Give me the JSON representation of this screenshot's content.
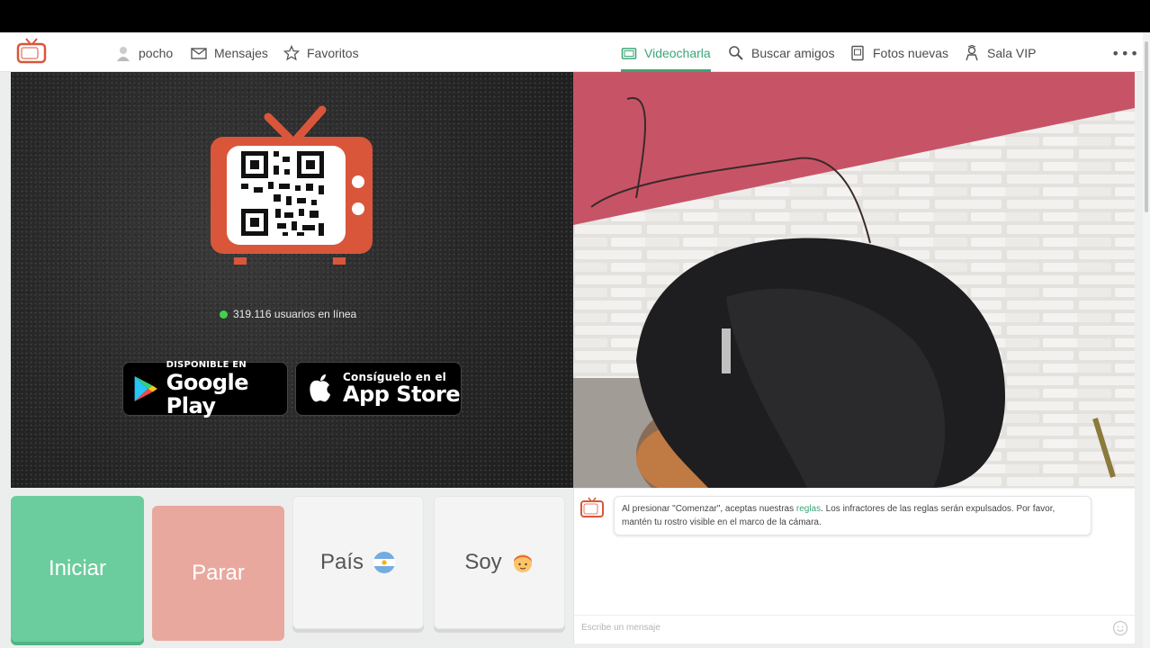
{
  "nav": {
    "user": "pocho",
    "messages": "Mensajes",
    "favorites": "Favoritos",
    "videochat": "Videocharla",
    "search_friends": "Buscar amigos",
    "new_photos": "Fotos nuevas",
    "vip_room": "Sala VIP",
    "more": "•••",
    "accent_color": "#3aa676"
  },
  "left_pane": {
    "online_count": "319.116 usuarios en línea",
    "google_play": {
      "small": "DISPONIBLE EN",
      "big": "Google Play"
    },
    "app_store": {
      "small": "Consíguelo en el",
      "big": "App Store"
    }
  },
  "controls": {
    "start": "Iniciar",
    "stop": "Parar",
    "country": "País",
    "soy": "Soy",
    "start_color": "#6bcd9d",
    "stop_color": "#e9a89e"
  },
  "chat": {
    "message_pre": "Al presionar \"Comenzar\", aceptas nuestras ",
    "message_link": "reglas",
    "message_post": ". Los infractores de las reglas serán expulsados. Por favor, mantén tu rostro visible en el marco de la cámara.",
    "input_placeholder": "Escribe un mensaje"
  }
}
